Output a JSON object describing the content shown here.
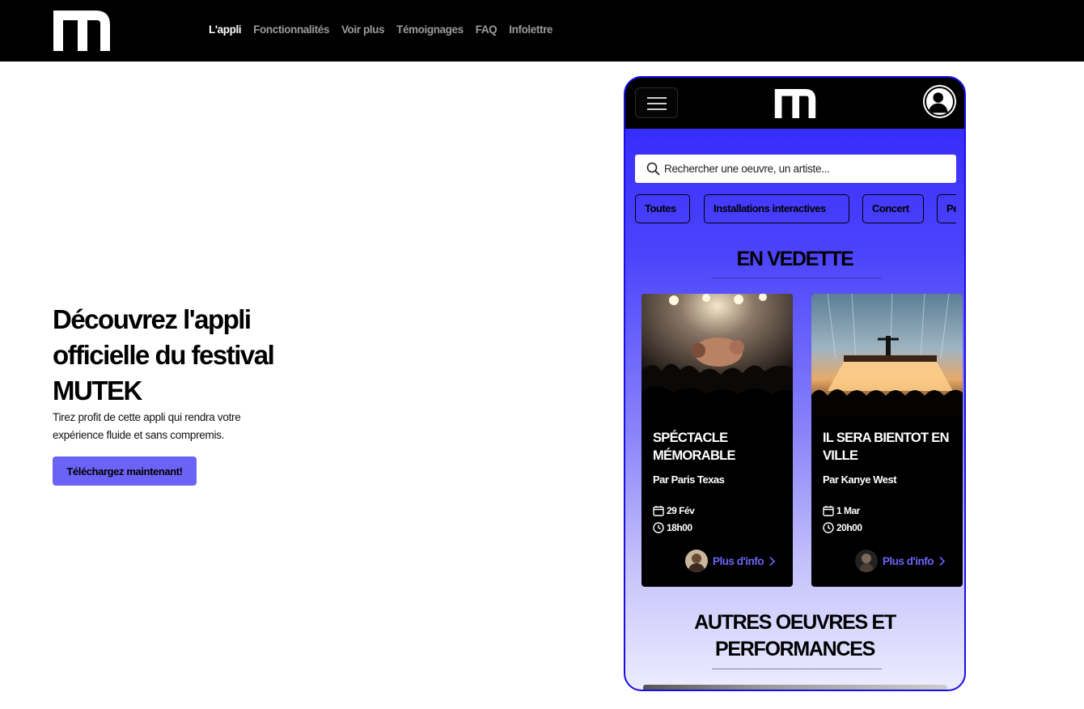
{
  "nav": {
    "links": [
      "L'appli",
      "Fonctionnalités",
      "Voir plus",
      "Témoignages",
      "FAQ",
      "Infolettre"
    ],
    "active": "L'appli"
  },
  "hero": {
    "title": "Découvrez l'appli officielle du festival MUTEK",
    "subtitle": "Tirez profit de cette appli qui rendra votre expérience fluide et sans compremis.",
    "cta": "Téléchargez maintenant!"
  },
  "app": {
    "search_placeholder": "Rechercher une oeuvre, un artiste...",
    "chips": [
      "Toutes",
      "Installations interactives",
      "Concert",
      "Pe"
    ],
    "featured_title": "EN VEDETTE",
    "cards": [
      {
        "title": "SPÉCTACLE MÉMORABLE",
        "artist": "Par Paris Texas",
        "date": "29 Fév",
        "time": "18h00",
        "more": "Plus d'info"
      },
      {
        "title": "IL SERA BIENTOT EN VILLE",
        "artist": "Par Kanye West",
        "date": "1 Mar",
        "time": "20h00",
        "more": "Plus d'info"
      }
    ],
    "others_title": "AUTRES OEUVRES ET PERFORMANCES"
  },
  "colors": {
    "accent": "#6b63f5",
    "phone_blue": "#2f24fb",
    "link_purple": "#6d64f8"
  },
  "icons": [
    "mutek-logo",
    "hamburger-menu-icon",
    "profile-icon",
    "search-icon",
    "calendar-icon",
    "clock-icon",
    "chevron-right-icon"
  ]
}
